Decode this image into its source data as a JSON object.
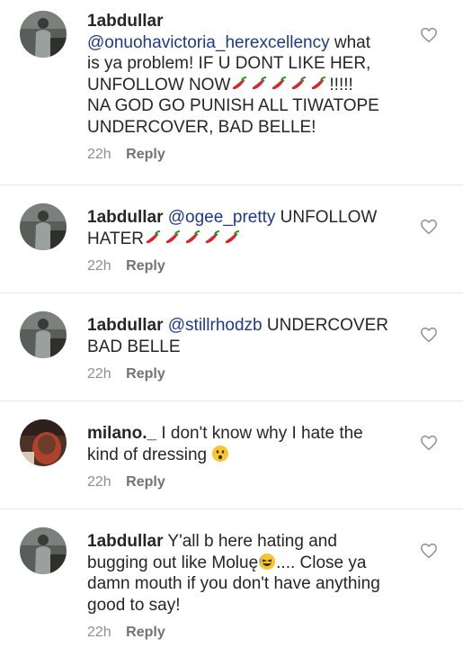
{
  "comments": [
    {
      "username": "1abdullar",
      "mention": "@onuohavictoria_herexcellency",
      "lines": [
        " what",
        "is ya problem! IF U DONT LIKE HER,",
        "UNFOLLOW NOW",
        "!!!!!",
        "NA GOD GO PUNISH ALL TIWATOPE",
        "UNDERCOVER, BAD BELLE!"
      ],
      "time": "22h",
      "reply": "Reply"
    },
    {
      "username": "1abdullar",
      "mention": "@ogee_pretty",
      "lines": [
        " UNFOLLOW",
        "HATER"
      ],
      "time": "22h",
      "reply": "Reply"
    },
    {
      "username": "1abdullar",
      "mention": "@stillrhodzb",
      "lines": [
        " UNDERCOVER",
        "BAD BELLE"
      ],
      "time": "22h",
      "reply": "Reply"
    },
    {
      "username": "milano._",
      "mention": "",
      "lines": [
        " I don't know why I hate the",
        "kind of dressing "
      ],
      "time": "22h",
      "reply": "Reply"
    },
    {
      "username": "1abdullar",
      "mention": "",
      "lines": [
        " Y'all b here hating and",
        "bugging out like Moluę",
        ".... Close ya",
        "damn mouth if you don't have anything",
        "good to say!"
      ],
      "time": "22h",
      "reply": "Reply"
    }
  ],
  "icons": {
    "like": "heart-outline-icon",
    "pepper": "hot-pepper-emoji",
    "sad": "worried-face-emoji",
    "laugh": "laughing-face-emoji"
  },
  "colors": {
    "text": "#262626",
    "mention": "#1e3a8a",
    "meta": "#8e8e8e",
    "divider": "#e6e6e6"
  }
}
